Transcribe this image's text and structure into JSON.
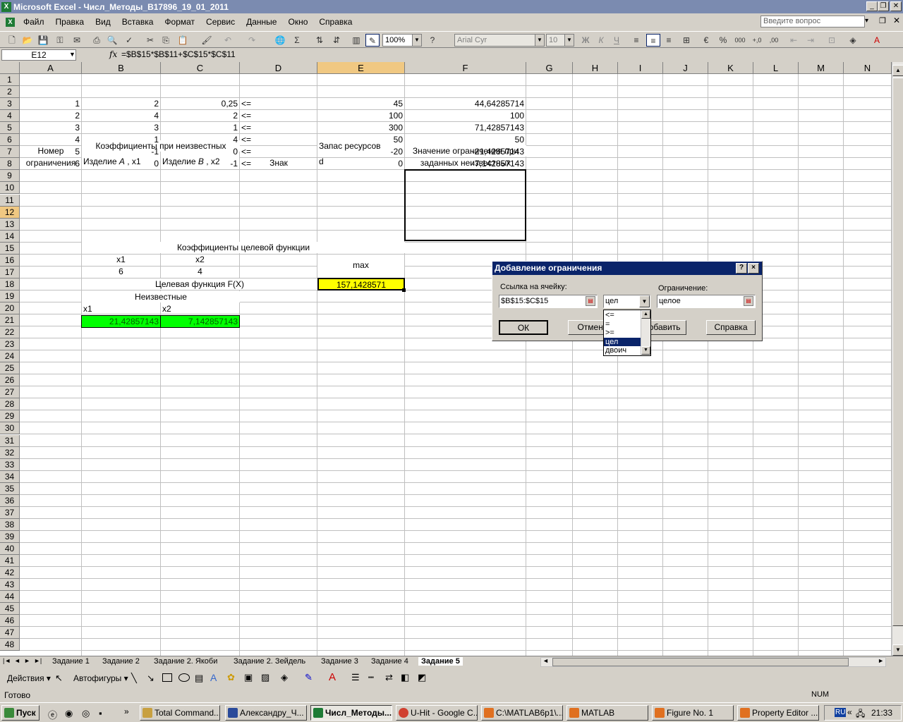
{
  "window": {
    "title": "Microsoft Excel - Числ_Методы_В17896_19_01_2011"
  },
  "menu": {
    "items": [
      "Файл",
      "Правка",
      "Вид",
      "Вставка",
      "Формат",
      "Сервис",
      "Данные",
      "Окно",
      "Справка"
    ],
    "ask_placeholder": "Введите вопрос"
  },
  "toolbar": {
    "zoom": "100%",
    "font_name": "Arial Cyr",
    "font_size": "10"
  },
  "formula_bar": {
    "name_box": "E12",
    "fx": "fx",
    "formula": "=$B$15*$B$11+$C$15*$C$11"
  },
  "columns": [
    "A",
    "B",
    "C",
    "D",
    "E",
    "F",
    "G",
    "H",
    "I",
    "J",
    "K",
    "L",
    "M",
    "N"
  ],
  "rows": [
    "1",
    "2",
    "3",
    "4",
    "5",
    "6",
    "7",
    "8",
    "9",
    "10",
    "11",
    "12",
    "13",
    "14",
    "15",
    "16",
    "17",
    "18",
    "19",
    "20",
    "21",
    "22",
    "23",
    "24",
    "25",
    "26",
    "27",
    "28",
    "29",
    "30",
    "31",
    "32",
    "33",
    "34",
    "35",
    "36",
    "37",
    "38",
    "39",
    "40",
    "41",
    "42",
    "43",
    "44",
    "45",
    "46",
    "47",
    "48"
  ],
  "sheet": {
    "a1": "Номер",
    "a2": "ограничения",
    "b1": "Коэффициенты при неизвестных",
    "b2_text": "Изделие ",
    "b2_italic": "А",
    "b2_suffix": " , x1",
    "c2_text": "Изделие ",
    "c2_italic": "В",
    "c2_suffix": " , x2",
    "d2": "Знак",
    "e1": "Запас ресурсов",
    "e2": "d",
    "f1": "Значение ограничения при",
    "f2": "заданных неизвестных",
    "table_rows": [
      {
        "a": "1",
        "b": "2",
        "c": "0,25",
        "d": "<=",
        "e": "45",
        "f": "44,64285714"
      },
      {
        "a": "2",
        "b": "4",
        "c": "2",
        "d": "<=",
        "e": "100",
        "f": "100"
      },
      {
        "a": "3",
        "b": "3",
        "c": "1",
        "d": "<=",
        "e": "300",
        "f": "71,42857143"
      },
      {
        "a": "4",
        "b": "1",
        "c": "4",
        "d": "<=",
        "e": "50",
        "f": "50"
      },
      {
        "a": "5",
        "b": "-1",
        "c": "0",
        "d": "<=",
        "e": "-20",
        "f": "-21,42857143"
      },
      {
        "a": "6",
        "b": "0",
        "c": "-1",
        "d": "<=",
        "e": "0",
        "f": "-7,142857143"
      }
    ],
    "obj_title": "Коэффициенты целевой функции",
    "b10": "x1",
    "c10": "x2",
    "b11": "6",
    "c11": "4",
    "e10": "max",
    "obj_label": "Целевая функция F(X)",
    "e12": "157,1428571",
    "unknowns_title": "Неизвестные",
    "b14": "x1",
    "c14": "x2",
    "b15": "21,42857143",
    "c15": "7,142857143"
  },
  "dialog": {
    "title": "Добавление ограничения",
    "help_btn": "?",
    "close_btn": "×",
    "ref_label": "Ссылка на ячейку:",
    "ref_value": "$B$15:$C$15",
    "op_value": "цел",
    "constraint_label": "Ограничение:",
    "constraint_value": "целое",
    "ok": "ОК",
    "cancel": "Отмена",
    "add": "Добавить",
    "help": "Справка",
    "options": [
      "<=",
      "=",
      ">=",
      "цел",
      "двоич"
    ],
    "selected_option": "цел"
  },
  "tabs": [
    "Задание 1",
    "Задание 2",
    "Задание 2. Якоби",
    "Задание 2. Зейдель",
    "Задание 3",
    "Задание 4",
    "Задание 5"
  ],
  "active_tab": "Задание 5",
  "drawbar": {
    "actions": "Действия",
    "autoshapes": "Автофигуры"
  },
  "status": {
    "ready": "Готово",
    "num": "NUM"
  },
  "taskbar": {
    "start": "Пуск",
    "tasks": [
      "Total Command...",
      "Александру_Ч...",
      "Числ_Методы...",
      "U-Hit - Google C...",
      "C:\\MATLAB6p1\\...",
      "MATLAB",
      "Figure No. 1",
      "Property Editor ..."
    ],
    "active_task": "Числ_Методы...",
    "lang": "RU",
    "clock": "21:33"
  },
  "colors": {
    "title_inactive": "#7b8bb0",
    "dialog_title": "#0a246a",
    "objective_cell": "#ffff00",
    "variable_cells": "#00ff00",
    "header_selected": "#f0c882"
  }
}
